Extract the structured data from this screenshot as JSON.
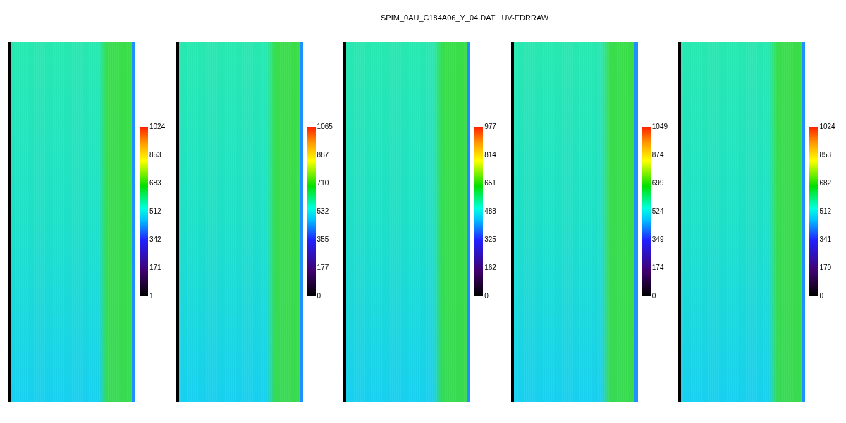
{
  "title": "SPIM_0AU_C184A06_Y_04.DAT   UV-EDRRAW",
  "panels": [
    {
      "colorbar_labels": [
        "1024",
        "853",
        "683",
        "512",
        "342",
        "171",
        "1"
      ]
    },
    {
      "colorbar_labels": [
        "1065",
        "887",
        "710",
        "532",
        "355",
        "177",
        "0"
      ]
    },
    {
      "colorbar_labels": [
        "977",
        "814",
        "651",
        "488",
        "325",
        "162",
        "0"
      ]
    },
    {
      "colorbar_labels": [
        "1049",
        "874",
        "699",
        "524",
        "349",
        "174",
        "0"
      ]
    },
    {
      "colorbar_labels": [
        "1024",
        "853",
        "682",
        "512",
        "341",
        "170",
        "0"
      ]
    }
  ]
}
